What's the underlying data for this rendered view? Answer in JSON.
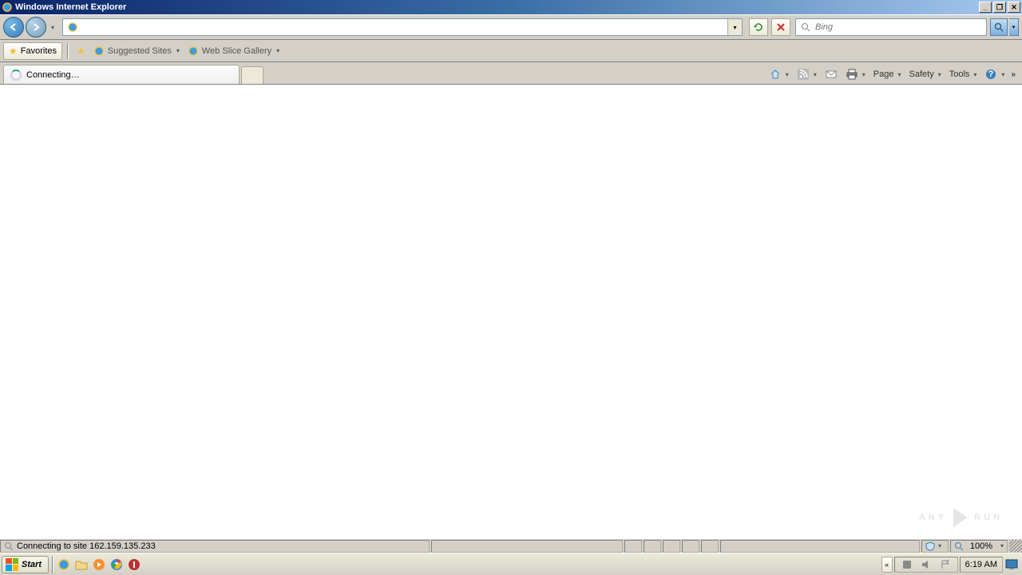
{
  "titlebar": {
    "title": "Windows Internet Explorer"
  },
  "navbar": {
    "address_value": "",
    "search_placeholder": "Bing"
  },
  "favbar": {
    "favorites_label": "Favorites",
    "suggested_label": "Suggested Sites",
    "webslice_label": "Web Slice Gallery"
  },
  "tabbar": {
    "tab_label": "Connecting…"
  },
  "cmdbar": {
    "page": "Page",
    "safety": "Safety",
    "tools": "Tools"
  },
  "statusbar": {
    "text": "Connecting to site 162.159.135.233",
    "zoom": "100%"
  },
  "taskbar": {
    "start": "Start",
    "clock": "6:19 AM"
  },
  "watermark": {
    "left": "ANY",
    "right": "RUN"
  }
}
